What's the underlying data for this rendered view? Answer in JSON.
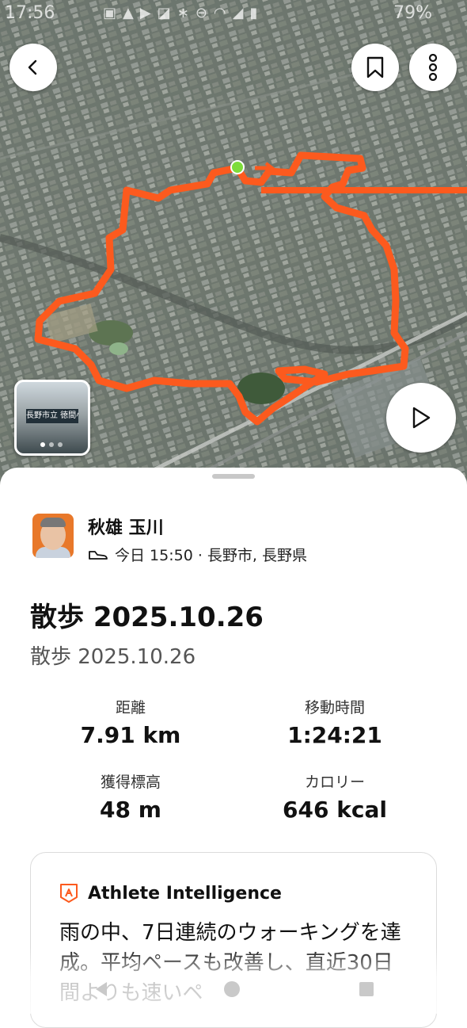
{
  "status_bar": {
    "time": "17:56",
    "battery": "79%",
    "icons": [
      "notification-icon",
      "alert-icon",
      "youtube-icon",
      "app-icon",
      "bluetooth-icon",
      "dnd-icon",
      "wifi-icon",
      "signal-icon",
      "battery-icon"
    ]
  },
  "map": {
    "route_color": "#fc5a1e",
    "start_marker_color": "#7ddc3a",
    "photo_sign_text": "長野市立 徳間小学校",
    "photo_pages": 3,
    "photo_current_page": 1
  },
  "activity": {
    "athlete_name": "秋雄 玉川",
    "meta": "今日 15:50 · 長野市, 長野県",
    "title": "散歩 2025.10.26",
    "subtitle": "散歩 2025.10.26",
    "stats": [
      {
        "label": "距離",
        "value": "7.91 km"
      },
      {
        "label": "移動時間",
        "value": "1:24:21"
      },
      {
        "label": "獲得標高",
        "value": "48 m"
      },
      {
        "label": "カロリー",
        "value": "646 kcal"
      }
    ]
  },
  "intelligence": {
    "title": "Athlete Intelligence",
    "text": "雨の中、7日連続のウォーキングを達成。平均ペースも改善し、直近30日間よりも速いペ",
    "brand_color": "#fc5a1e"
  }
}
